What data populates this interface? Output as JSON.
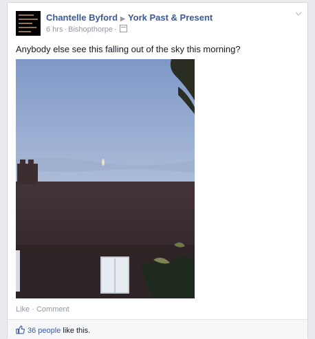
{
  "post": {
    "author": "Chantelle Byford",
    "group": "York Past & Present",
    "time": "6 hrs",
    "location": "Bishopthorpe",
    "message": "Anybody else see this falling out of the sky this morning?",
    "actions": {
      "like": "Like",
      "comment": "Comment",
      "separator": "·"
    },
    "likes": {
      "count_label": "36 people",
      "suffix": " like this."
    },
    "icons": {
      "arrow": "right-triangle-icon",
      "audience": "calendar-icon",
      "menu": "chevron-down-icon",
      "like": "thumbs-up-icon"
    }
  },
  "colors": {
    "link": "#3b5998",
    "muted": "#9197a3",
    "text": "#141823"
  }
}
